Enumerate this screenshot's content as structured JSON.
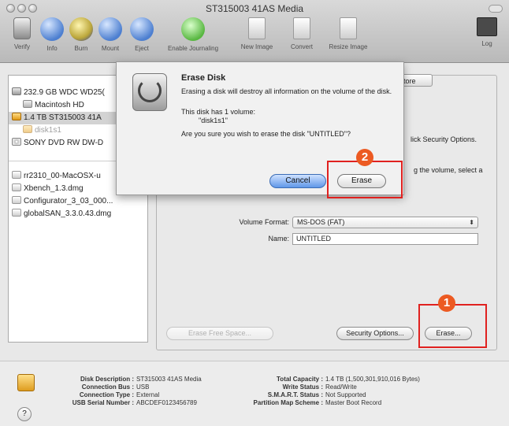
{
  "window": {
    "title": "ST315003 41AS Media"
  },
  "toolbar": {
    "items": [
      {
        "label": "Verify",
        "icon": "verify-icon"
      },
      {
        "label": "Info",
        "icon": "info-icon"
      },
      {
        "label": "Burn",
        "icon": "burn-icon"
      },
      {
        "label": "Mount",
        "icon": "mount-icon"
      },
      {
        "label": "Eject",
        "icon": "eject-icon"
      },
      {
        "label": "Enable Journaling",
        "icon": "journaling-icon"
      },
      {
        "label": "New Image",
        "icon": "new-image-icon"
      },
      {
        "label": "Convert",
        "icon": "convert-icon"
      },
      {
        "label": "Resize Image",
        "icon": "resize-image-icon"
      },
      {
        "label": "Log",
        "icon": "log-icon"
      }
    ]
  },
  "sidebar": {
    "items": [
      {
        "label": "232.9 GB WDC WD25(",
        "kind": "disk"
      },
      {
        "label": "Macintosh HD",
        "kind": "volume"
      },
      {
        "label": "1.4 TB ST315003 41A",
        "kind": "disk-selected"
      },
      {
        "label": "disk1s1",
        "kind": "volume-muted"
      },
      {
        "label": "SONY DVD RW DW-D",
        "kind": "dvd"
      },
      {
        "label": "rr2310_00-MacOSX-u",
        "kind": "image"
      },
      {
        "label": "Xbench_1.3.dmg",
        "kind": "image"
      },
      {
        "label": "Configurator_3_03_000...",
        "kind": "image"
      },
      {
        "label": "globalSAN_3.3.0.43.dmg",
        "kind": "image"
      }
    ]
  },
  "main": {
    "tab_restore": "tore",
    "hint1": "lick Security Options.",
    "hint2": "g the volume, select a",
    "volume_format_label": "Volume Format:",
    "volume_format_value": "MS-DOS (FAT)",
    "name_label": "Name:",
    "name_value": "UNTITLED",
    "erase_free_space": "Erase Free Space...",
    "security_options": "Security Options...",
    "erase": "Erase..."
  },
  "dialog": {
    "title": "Erase Disk",
    "body": "Erasing a disk will destroy all information on the volume of the disk.",
    "volume_count": "This disk has 1 volume:",
    "volume_name": "\"disk1s1\"",
    "question": "Are you sure you wish to erase the disk \"UNTITLED\"?",
    "cancel": "Cancel",
    "erase": "Erase"
  },
  "footer": {
    "left": [
      {
        "key": "Disk Description :",
        "value": "ST315003 41AS Media"
      },
      {
        "key": "Connection Bus :",
        "value": "USB"
      },
      {
        "key": "Connection Type :",
        "value": "External"
      },
      {
        "key": "USB Serial Number :",
        "value": "ABCDEF0123456789"
      }
    ],
    "right": [
      {
        "key": "Total Capacity :",
        "value": "1.4 TB (1,500,301,910,016 Bytes)"
      },
      {
        "key": "Write Status :",
        "value": "Read/Write"
      },
      {
        "key": "S.M.A.R.T. Status :",
        "value": "Not Supported"
      },
      {
        "key": "Partition Map Scheme :",
        "value": "Master Boot Record"
      }
    ],
    "help": "?"
  },
  "annotations": {
    "step1": "1",
    "step2": "2",
    "color": "#e0211f"
  }
}
